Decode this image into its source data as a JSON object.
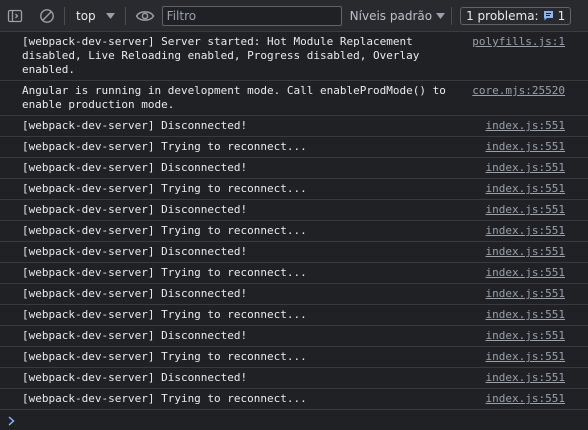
{
  "toolbar": {
    "context": "top",
    "filter_placeholder": "Filtro",
    "filter_value": "",
    "levels": "Níveis padrão",
    "issues_label": "1 problema:",
    "issues_count": "1",
    "icons": [
      "sidebar-icon",
      "clear-console-icon",
      "chevron-down-icon",
      "eye-icon",
      "chevron-down-icon",
      "issue-message-icon",
      "gear-icon"
    ],
    "accent_color": "#8ab4f8"
  },
  "console": {
    "messages": [
      {
        "text": "[webpack-dev-server] Server started: Hot Module Replacement\ndisabled, Live Reloading enabled, Progress disabled, Overlay enabled.",
        "source": "polyfills.js:1"
      },
      {
        "text": "Angular is running in development mode. Call enableProdMode() to\nenable production mode.",
        "source": "core.mjs:25520"
      },
      {
        "text": "[webpack-dev-server] Disconnected!",
        "source": "index.js:551"
      },
      {
        "text": "[webpack-dev-server] Trying to reconnect...",
        "source": "index.js:551"
      },
      {
        "text": "[webpack-dev-server] Disconnected!",
        "source": "index.js:551"
      },
      {
        "text": "[webpack-dev-server] Trying to reconnect...",
        "source": "index.js:551"
      },
      {
        "text": "[webpack-dev-server] Disconnected!",
        "source": "index.js:551"
      },
      {
        "text": "[webpack-dev-server] Trying to reconnect...",
        "source": "index.js:551"
      },
      {
        "text": "[webpack-dev-server] Disconnected!",
        "source": "index.js:551"
      },
      {
        "text": "[webpack-dev-server] Trying to reconnect...",
        "source": "index.js:551"
      },
      {
        "text": "[webpack-dev-server] Disconnected!",
        "source": "index.js:551"
      },
      {
        "text": "[webpack-dev-server] Trying to reconnect...",
        "source": "index.js:551"
      },
      {
        "text": "[webpack-dev-server] Disconnected!",
        "source": "index.js:551"
      },
      {
        "text": "[webpack-dev-server] Trying to reconnect...",
        "source": "index.js:551"
      },
      {
        "text": "[webpack-dev-server] Disconnected!",
        "source": "index.js:551"
      },
      {
        "text": "[webpack-dev-server] Trying to reconnect...",
        "source": "index.js:551"
      }
    ],
    "prompt_icon": "chevron-right-icon",
    "prompt_color": "#8ab4f8"
  }
}
